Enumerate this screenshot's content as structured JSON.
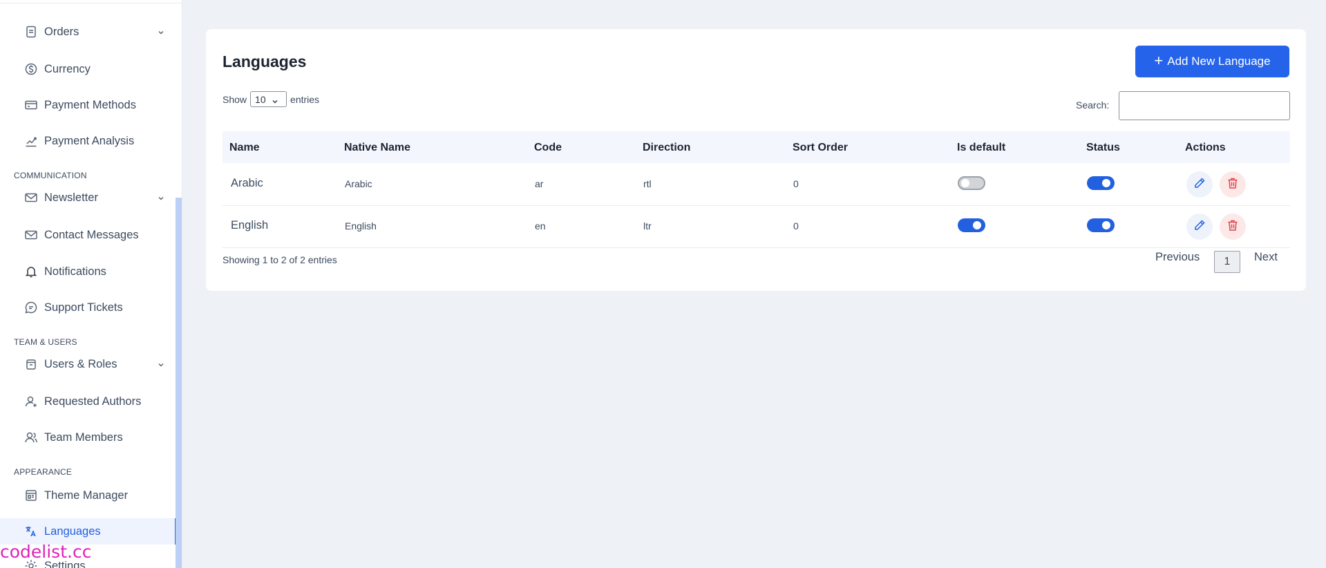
{
  "sidebar": {
    "items": [
      {
        "label": "Orders",
        "icon": "orders-icon",
        "chevron": true
      },
      {
        "label": "Currency",
        "icon": "currency-icon"
      },
      {
        "label": "Payment Methods",
        "icon": "credit-card-icon"
      },
      {
        "label": "Payment Analysis",
        "icon": "analysis-icon"
      },
      {
        "label": "Newsletter",
        "icon": "mail-icon",
        "chevron": true
      },
      {
        "label": "Contact Messages",
        "icon": "envelope-icon"
      },
      {
        "label": "Notifications",
        "icon": "bell-icon"
      },
      {
        "label": "Support Tickets",
        "icon": "chat-icon"
      },
      {
        "label": "Users & Roles",
        "icon": "users-roles-icon",
        "chevron": true
      },
      {
        "label": "Requested Authors",
        "icon": "user-icon"
      },
      {
        "label": "Team Members",
        "icon": "team-icon"
      },
      {
        "label": "Theme Manager",
        "icon": "theme-icon"
      },
      {
        "label": "Languages",
        "icon": "translate-icon",
        "active": true
      },
      {
        "label": "Settings",
        "icon": "settings-icon"
      }
    ],
    "sections": [
      "COMMUNICATION",
      "TEAM & USERS",
      "APPEARANCE"
    ],
    "brand": "codelist.cc"
  },
  "page": {
    "title": "Languages",
    "add_button": "Add New Language",
    "show_label": "Show",
    "entries_label": "entries",
    "page_size": "10",
    "search_label": "Search:",
    "search_value": ""
  },
  "table": {
    "columns": [
      "Name",
      "Native Name",
      "Code",
      "Direction",
      "Sort Order",
      "Is default",
      "Status",
      "Actions"
    ],
    "rows": [
      {
        "name": "Arabic",
        "native": "Arabic",
        "code": "ar",
        "direction": "rtl",
        "sort": "0",
        "is_default": false,
        "status": true
      },
      {
        "name": "English",
        "native": "English",
        "code": "en",
        "direction": "ltr",
        "sort": "0",
        "is_default": true,
        "status": true
      }
    ]
  },
  "footer": {
    "info": "Showing 1 to 2 of 2 entries",
    "previous": "Previous",
    "page": "1",
    "next": "Next"
  },
  "colors": {
    "accent": "#2563eb",
    "danger": "#e0444c",
    "background": "#eef1f5"
  }
}
